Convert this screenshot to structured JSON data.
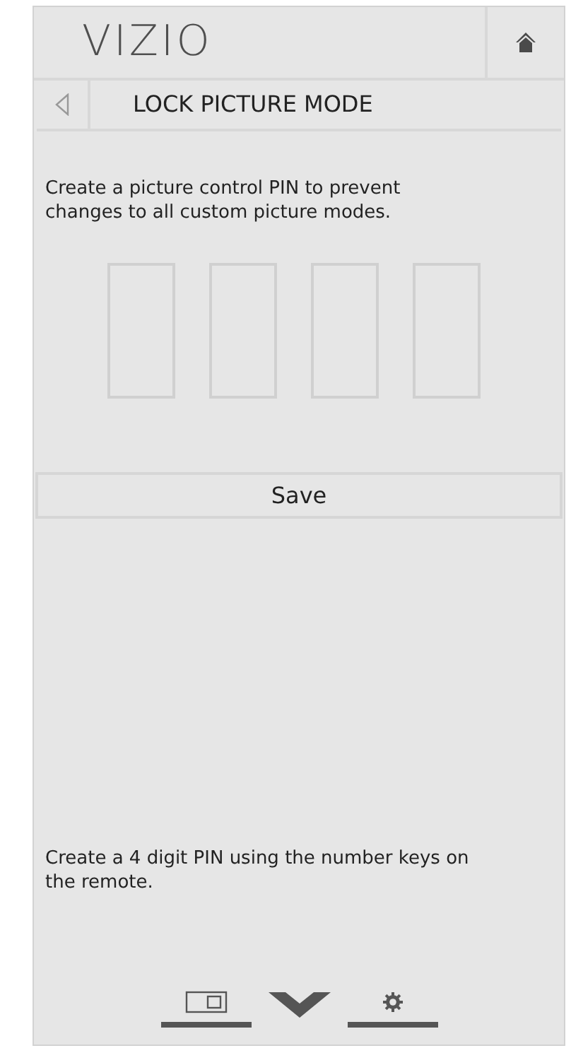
{
  "logo": "VIZIO",
  "title": "LOCK PICTURE MODE",
  "description": "Create a picture control PIN to prevent changes to all custom picture modes.",
  "pin_digits": [
    {
      "filled": false
    },
    {
      "filled": false
    },
    {
      "filled": false
    },
    {
      "filled": false
    }
  ],
  "save_button": "Save",
  "hint": "Create a 4 digit PIN using the number keys on the remote."
}
